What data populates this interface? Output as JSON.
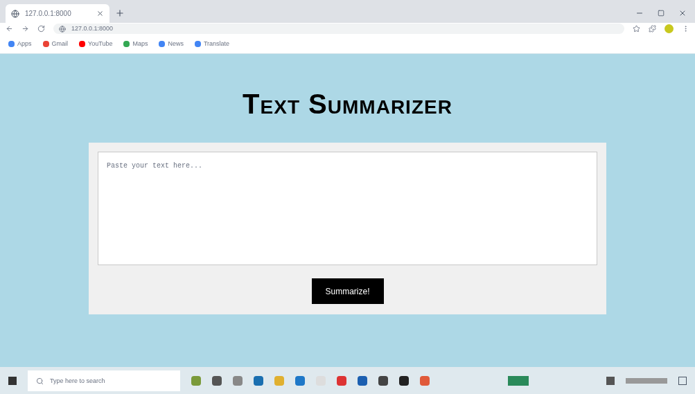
{
  "browser": {
    "tab": {
      "title": "127.0.0.1:8000",
      "selected": true
    },
    "address": "127.0.0.1:8000",
    "bookmarks": [
      {
        "label": "Apps",
        "color": "#4285f4"
      },
      {
        "label": "Gmail",
        "color": "#ea4335"
      },
      {
        "label": "YouTube",
        "color": "#ff0000"
      },
      {
        "label": "Maps",
        "color": "#34a853"
      },
      {
        "label": "News",
        "color": "#4285f4"
      },
      {
        "label": "Translate",
        "color": "#4285f4"
      }
    ]
  },
  "page": {
    "heading": "Text Summarizer",
    "textarea": {
      "placeholder": "Paste your text here..."
    },
    "button": "Summarize!"
  },
  "taskbar": {
    "search": {
      "placeholder": "Type here to search"
    }
  }
}
